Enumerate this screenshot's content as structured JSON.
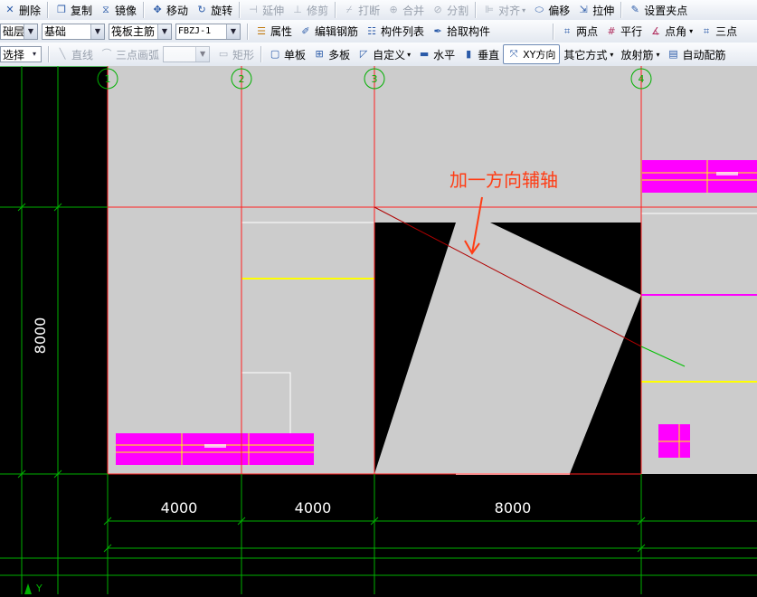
{
  "toolbar1": {
    "items": [
      {
        "label": "删除",
        "icon": "delete-icon",
        "enabled": true
      },
      {
        "label": "复制",
        "icon": "copy-icon",
        "enabled": true
      },
      {
        "label": "镜像",
        "icon": "mirror-icon",
        "enabled": true
      },
      {
        "label": "移动",
        "icon": "move-icon",
        "enabled": true
      },
      {
        "label": "旋转",
        "icon": "rotate-icon",
        "enabled": true
      },
      {
        "label": "延伸",
        "icon": "extend-icon",
        "enabled": false
      },
      {
        "label": "修剪",
        "icon": "trim-icon",
        "enabled": false
      },
      {
        "label": "打断",
        "icon": "break-icon",
        "enabled": false
      },
      {
        "label": "合并",
        "icon": "merge-icon",
        "enabled": false
      },
      {
        "label": "分割",
        "icon": "split-icon",
        "enabled": false
      },
      {
        "label": "对齐",
        "icon": "align-icon",
        "enabled": false
      },
      {
        "label": "偏移",
        "icon": "offset-icon",
        "enabled": true
      },
      {
        "label": "拉伸",
        "icon": "stretch-icon",
        "enabled": true
      },
      {
        "label": "设置夹点",
        "icon": "grip-icon",
        "enabled": true
      }
    ]
  },
  "toolbar2": {
    "floor_select": "础层",
    "category_select": "基础",
    "type_select": "筏板主筋",
    "component_select": "FBZJ-1",
    "properties_label": "属性",
    "edit_rebar_label": "编辑钢筋",
    "component_list_label": "构件列表",
    "pick_component_label": "拾取构件",
    "two_point_label": "两点",
    "parallel_label": "平行",
    "point_angle_label": "点角",
    "three_point_label": "三点"
  },
  "toolbar3": {
    "select_label": "选择",
    "line_label": "直线",
    "arc_label": "三点画弧",
    "rect_label": "矩形",
    "single_board_label": "单板",
    "multi_board_label": "多板",
    "custom_label": "自定义",
    "horizontal_label": "水平",
    "vertical_label": "垂直",
    "xy_direction_label": "XY方向",
    "other_method_label": "其它方式",
    "radial_rebar_label": "放射筋",
    "auto_rebar_label": "自动配筋"
  },
  "canvas": {
    "annotation_text": "加一方向辅轴",
    "dimensions_horizontal": [
      "4000",
      "4000",
      "8000"
    ],
    "dimension_vertical": "8000",
    "axis_labels": [
      "1",
      "2",
      "3",
      "4"
    ],
    "ucs_label": "Y",
    "colors": {
      "background": "#000000",
      "slab": "#cccccc",
      "axis_line": "#ff2020",
      "rebar_highlight": "#ff00ff",
      "rebar_yellow": "#ffff00",
      "aux_axis": "#c00000",
      "dimension_line": "#00ff00",
      "annotation": "#ff3c14"
    }
  }
}
